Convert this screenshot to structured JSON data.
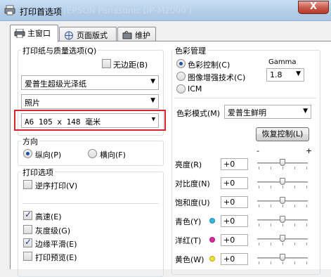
{
  "window": {
    "title": "打印首选项",
    "title_ghost": "(EPSON Panasonic DP-M2000 )",
    "close_label": "X"
  },
  "tabs": [
    {
      "label": "主窗口",
      "icon": "printer-icon"
    },
    {
      "label": "页面版式",
      "icon": "page-layout-icon"
    },
    {
      "label": "维护",
      "icon": "maintenance-icon"
    }
  ],
  "paper": {
    "group_label": "打印纸与质量选项(Q)",
    "borderless_label": "无边距(B)",
    "borderless_checked": false,
    "media_type": "爱普生超级光泽纸",
    "quality": "照片",
    "paper_size": "A6 105 x 148 毫米"
  },
  "orientation": {
    "group_label": "方向",
    "portrait_label": "纵向(P)",
    "landscape_label": "横向(F)",
    "selected": "portrait"
  },
  "print_options": {
    "group_label": "打印选项",
    "items": [
      {
        "label": "逆序打印(V)",
        "checked": false
      },
      {
        "label": "高速(E)",
        "checked": true
      },
      {
        "label": "灰度级(G)",
        "checked": false
      },
      {
        "label": "边缘平滑(E)",
        "checked": true
      },
      {
        "label": "打印预览(E)",
        "checked": false
      }
    ]
  },
  "color": {
    "group_label": "色彩管理",
    "options": [
      {
        "label": "色彩控制(C)",
        "selected": true
      },
      {
        "label": "图像增强技术(C)",
        "selected": false
      },
      {
        "label": "ICM",
        "selected": false
      }
    ],
    "gamma_label": "Gamma",
    "gamma_value": "1.8",
    "mode_label": "色彩模式(M)",
    "mode_value": "爱普生鲜明",
    "reset_label": "恢复控制(L)",
    "scale_minus": "-",
    "scale_plus": "+",
    "adjustments": [
      {
        "label": "亮度(R)",
        "value": "+0",
        "dot": null
      },
      {
        "label": "对比度(N)",
        "value": "+0",
        "dot": null
      },
      {
        "label": "饱和度(U)",
        "value": "+0",
        "dot": null
      },
      {
        "label": "青色(Y)",
        "value": "+0",
        "dot": "#2fb8e6"
      },
      {
        "label": "洋红(T)",
        "value": "+0",
        "dot": "#e0279b"
      },
      {
        "label": "黄色(W)",
        "value": "+0",
        "dot": "#f2e22a"
      }
    ]
  },
  "colors": {
    "highlight_border": "#d8262d",
    "titlebar": "#b9d1ea"
  }
}
